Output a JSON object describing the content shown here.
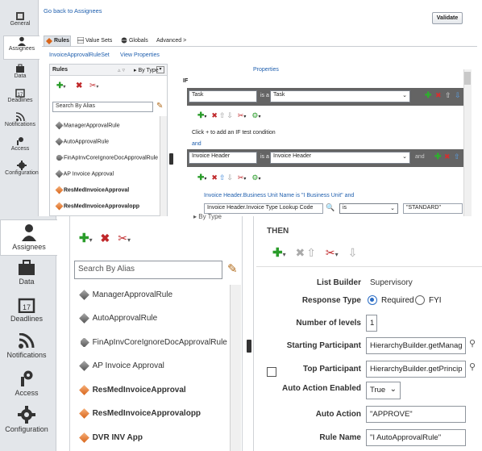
{
  "top": {
    "back_link": "Go back to Assignees",
    "validate": "Validate",
    "vtabs": [
      "General",
      "Assignees",
      "Data",
      "Deadlines",
      "Notifications",
      "Access",
      "Configuration"
    ],
    "tabs": [
      "Rules",
      "Value Sets",
      "Globals",
      "Advanced >"
    ],
    "ruleset": "InvoiceApprovalRuleSet",
    "view_props": "View Properties",
    "rules_header": "Rules",
    "by_type": "By Type",
    "properties": "Properties",
    "if_label": "IF",
    "search_placeholder": "Search By Alias",
    "rules": [
      {
        "name": "ManagerApprovalRule",
        "color": "grey"
      },
      {
        "name": "AutoApprovalRule",
        "color": "grey"
      },
      {
        "name": "FinApInvCoreIgnoreDocApprovalRule",
        "color": "grey"
      },
      {
        "name": "AP Invoice Approval",
        "color": "grey"
      },
      {
        "name": "ResMedInvoiceApproval",
        "color": "orange"
      },
      {
        "name": "ResMedInvoiceApprovalopp",
        "color": "orange"
      }
    ],
    "cond1_left": "Task",
    "cond1_op": "is a",
    "cond1_right": "Task",
    "click_add": "Click + to add an IF test condition",
    "and": "and",
    "cond2_left": "Invoice Header",
    "cond2_op": "is a",
    "cond2_right": "Invoice Header",
    "cond2_and": "and",
    "bu_text": "Invoice Header.Business Unit Name is \"I       Business Unit\" and",
    "type_field": "Invoice Header.Invoice Type Lookup Code",
    "type_op": "is",
    "type_val": "\"STANDARD\""
  },
  "bottom": {
    "vtabs": [
      "Assignees",
      "Data",
      "Deadlines",
      "Notifications",
      "Access",
      "Configuration"
    ],
    "search_placeholder": "Search By Alias",
    "rules": [
      {
        "name": "ManagerApprovalRule",
        "color": "grey"
      },
      {
        "name": "AutoApprovalRule",
        "color": "grey"
      },
      {
        "name": "FinApInvCoreIgnoreDocApprovalRule",
        "color": "grey"
      },
      {
        "name": "AP Invoice Approval",
        "color": "grey"
      },
      {
        "name": "ResMedInvoiceApproval",
        "color": "orange"
      },
      {
        "name": "ResMedInvoiceApprovalopp",
        "color": "orange"
      },
      {
        "name": "DVR INV App",
        "color": "orange"
      }
    ],
    "then": "THEN",
    "list_builder_label": "List Builder",
    "list_builder_value": "Supervisory",
    "response_type_label": "Response Type",
    "required": "Required",
    "fyi": "FYI",
    "levels_label": "Number of levels",
    "levels_value": "1",
    "starting_label": "Starting Participant",
    "starting_value": "HierarchyBuilder.getManag",
    "top_label": "Top Participant",
    "top_value": "HierarchyBuilder.getPrincip",
    "auto_enabled_label": "Auto Action Enabled",
    "auto_enabled_value": "True",
    "auto_action_label": "Auto Action",
    "auto_action_value": "\"APPROVE\"",
    "rule_name_label": "Rule Name",
    "rule_name_value": "\"I      AutoApprovalRule\""
  }
}
